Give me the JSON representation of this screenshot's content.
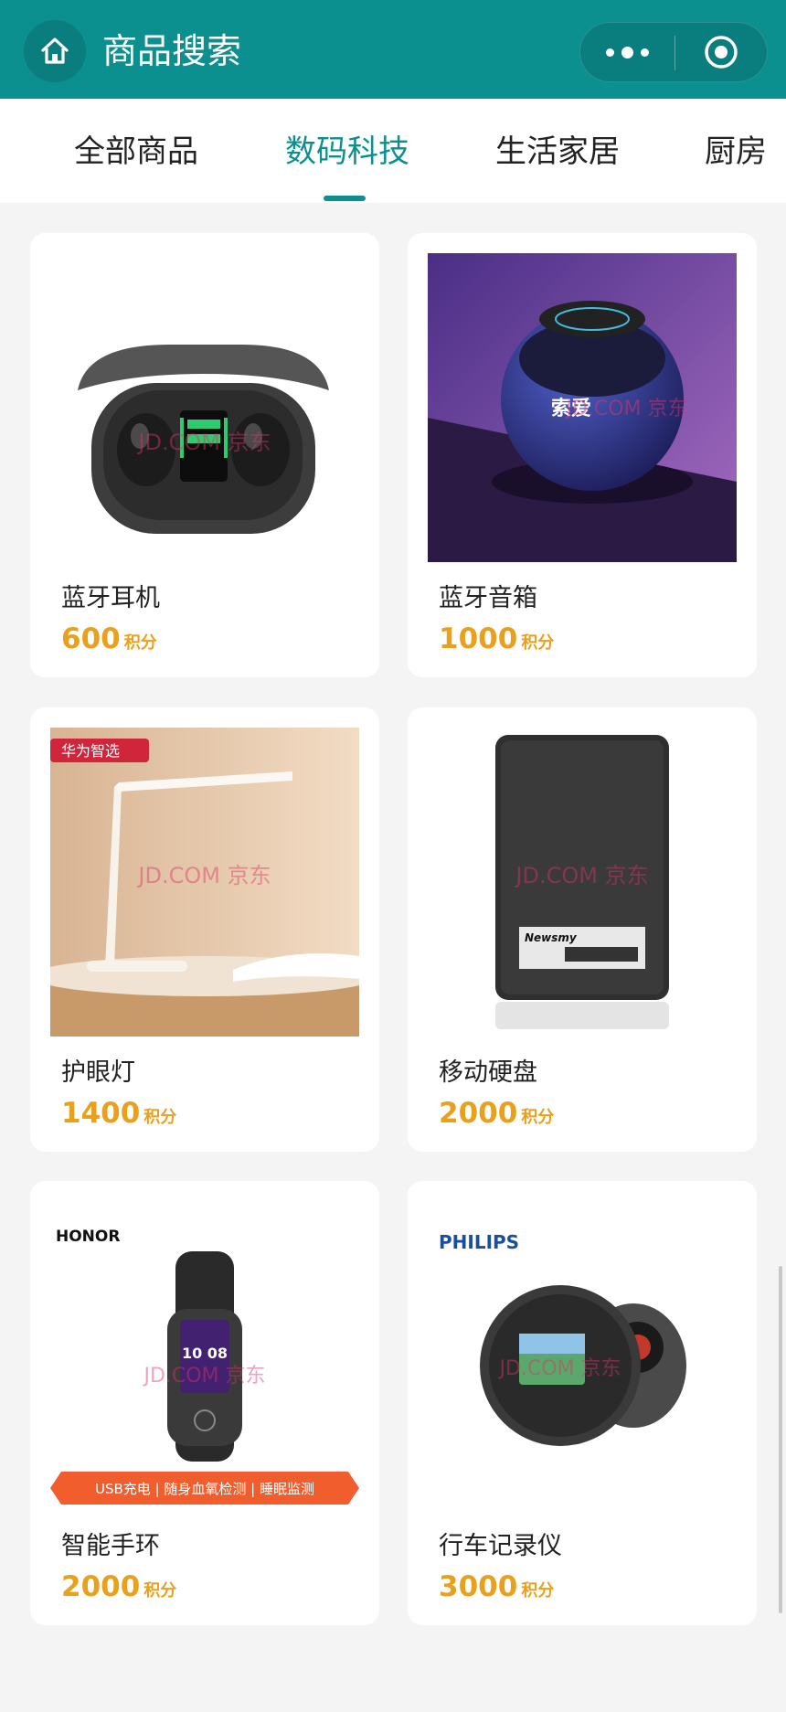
{
  "header": {
    "title": "商品搜索",
    "icons": {
      "home": "home-icon",
      "more": "more-dots-icon",
      "close": "target-circle-icon"
    }
  },
  "tabs": [
    {
      "label": "全部商品",
      "active": false
    },
    {
      "label": "数码科技",
      "active": true
    },
    {
      "label": "生活家居",
      "active": false
    },
    {
      "label": "厨房",
      "active": false
    }
  ],
  "products": [
    {
      "name": "蓝牙耳机",
      "points": "600",
      "unit": "积分",
      "image_brand": ""
    },
    {
      "name": "蓝牙音箱",
      "points": "1000",
      "unit": "积分",
      "image_brand": "索爱"
    },
    {
      "name": "护眼灯",
      "points": "1400",
      "unit": "积分",
      "image_brand": "华为智选"
    },
    {
      "name": "移动硬盘",
      "points": "2000",
      "unit": "积分",
      "image_brand": "Newsmy"
    },
    {
      "name": "智能手环",
      "points": "2000",
      "unit": "积分",
      "image_brand": "HONOR",
      "image_banner": "USB充电 | 随身血氧检测 | 睡眠监测",
      "image_screen": "10 08"
    },
    {
      "name": "行车记录仪",
      "points": "3000",
      "unit": "积分",
      "image_brand": "PHILIPS"
    }
  ],
  "watermark": "JD.COM 京东",
  "colors": {
    "primary": "#0b8f8f",
    "price": "#e9a11d",
    "background": "#f4f4f4"
  }
}
